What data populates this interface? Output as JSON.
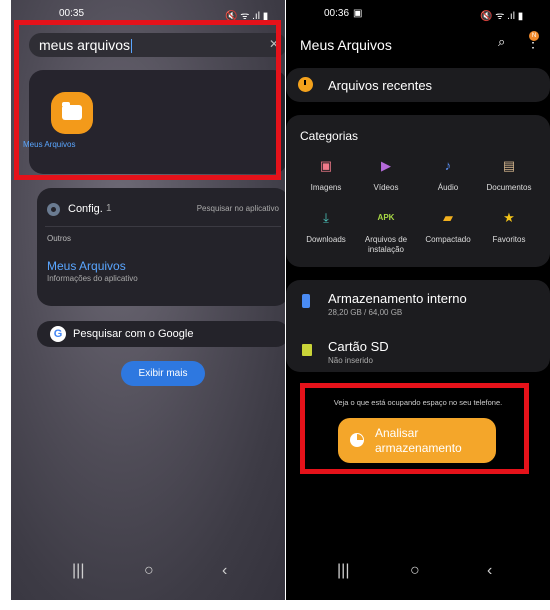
{
  "left_screen": {
    "time": "00:35",
    "status_icons": "🔇 ᯤ .ıl ▮",
    "search": {
      "value": "meus arquivos",
      "clear_icon": "close-icon"
    },
    "app_result": {
      "label": "Meus Arquivos",
      "icon": "folder-icon",
      "icon_color": "#f39a1a"
    },
    "settings_card": {
      "title": "Config.",
      "count": "1",
      "in_app": "Pesquisar no aplicativo",
      "section": "Outros",
      "app_name": "Meus Arquivos",
      "app_info": "Informações do aplicativo"
    },
    "google": {
      "label": "Pesquisar com o Google",
      "logo": "G"
    },
    "show_more": "Exibir mais",
    "nav": {
      "recents": "|||",
      "home": "○",
      "back": "‹"
    }
  },
  "right_screen": {
    "time": "00:36",
    "time_icon": "▣",
    "status_icons": "🔇 ᯤ .ıl ▮",
    "title": "Meus Arquivos",
    "search_icon": "⌕",
    "more_icon": "⋮",
    "badge": "N",
    "recent": "Arquivos recentes",
    "categories": {
      "title": "Categorias",
      "items": [
        {
          "label": "Imagens",
          "glyph": "▣",
          "color": "#f07a8a"
        },
        {
          "label": "Vídeos",
          "glyph": "▶",
          "color": "#b46ad9"
        },
        {
          "label": "Áudio",
          "glyph": "♪",
          "color": "#5a8ff2"
        },
        {
          "label": "Documentos",
          "glyph": "▤",
          "color": "#d2b48c"
        },
        {
          "label": "Downloads",
          "glyph": "⤓",
          "color": "#4ec9c0"
        },
        {
          "label": "Arquivos de instalação",
          "glyph": "APK",
          "color": "#a8d845"
        },
        {
          "label": "Compactado",
          "glyph": "▰",
          "color": "#f2b01e"
        },
        {
          "label": "Favoritos",
          "glyph": "★",
          "color": "#f2c318"
        }
      ]
    },
    "storage": {
      "internal": {
        "name": "Armazenamento interno",
        "detail": "28,20 GB / 64,00 GB"
      },
      "sd": {
        "name": "Cartão SD",
        "detail": "Não inserido"
      }
    },
    "analysis": {
      "text": "Veja o que está ocupando espaço no seu telefone.",
      "button": "Analisar armazenamento"
    },
    "nav": {
      "recents": "|||",
      "home": "○",
      "back": "‹"
    }
  },
  "colors": {
    "highlight": "#e5121a",
    "accent": "#f4a62a",
    "link": "#5aa6ff"
  }
}
